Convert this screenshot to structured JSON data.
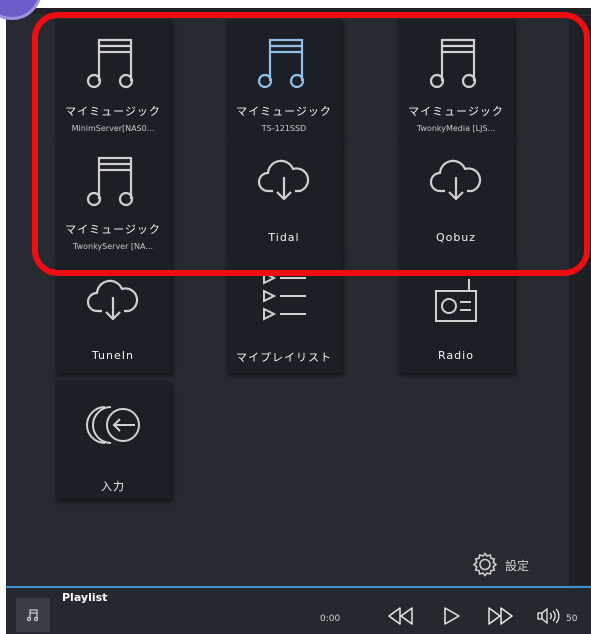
{
  "tiles": [
    {
      "title": "マイミュージック",
      "subtitle": "MinimServer[NAS0...",
      "icon": "music-note-icon"
    },
    {
      "title": "マイミュージック",
      "subtitle": "TS-121SSD",
      "icon": "music-note-icon"
    },
    {
      "title": "マイミュージック",
      "subtitle": "TwonkyMedia [LJS...",
      "icon": "music-note-icon"
    },
    {
      "title": "マイミュージック",
      "subtitle": "TwonkyServer [NA...",
      "icon": "music-note-icon"
    },
    {
      "title": "Tidal",
      "icon": "cloud-download-icon"
    },
    {
      "title": "Qobuz",
      "icon": "cloud-download-icon"
    },
    {
      "title": "TuneIn",
      "icon": "cloud-download-icon"
    },
    {
      "title": "マイプレイリスト",
      "icon": "playlist-icon"
    },
    {
      "title": "Radio",
      "icon": "radio-icon"
    },
    {
      "title": "入力",
      "icon": "input-icon"
    }
  ],
  "settings": {
    "label": "設定",
    "icon": "gear-icon"
  },
  "player": {
    "title": "Playlist",
    "time": "0:00",
    "volume": "50",
    "icons": [
      "music-note-icon",
      "previous-icon",
      "play-icon",
      "next-icon",
      "volume-icon"
    ]
  },
  "colors": {
    "background": "#282a32",
    "tile": "#1d1f26",
    "highlight": "#ee0e12",
    "accent_icon": "#8fc1e8",
    "progress": "#3d8fd6"
  }
}
